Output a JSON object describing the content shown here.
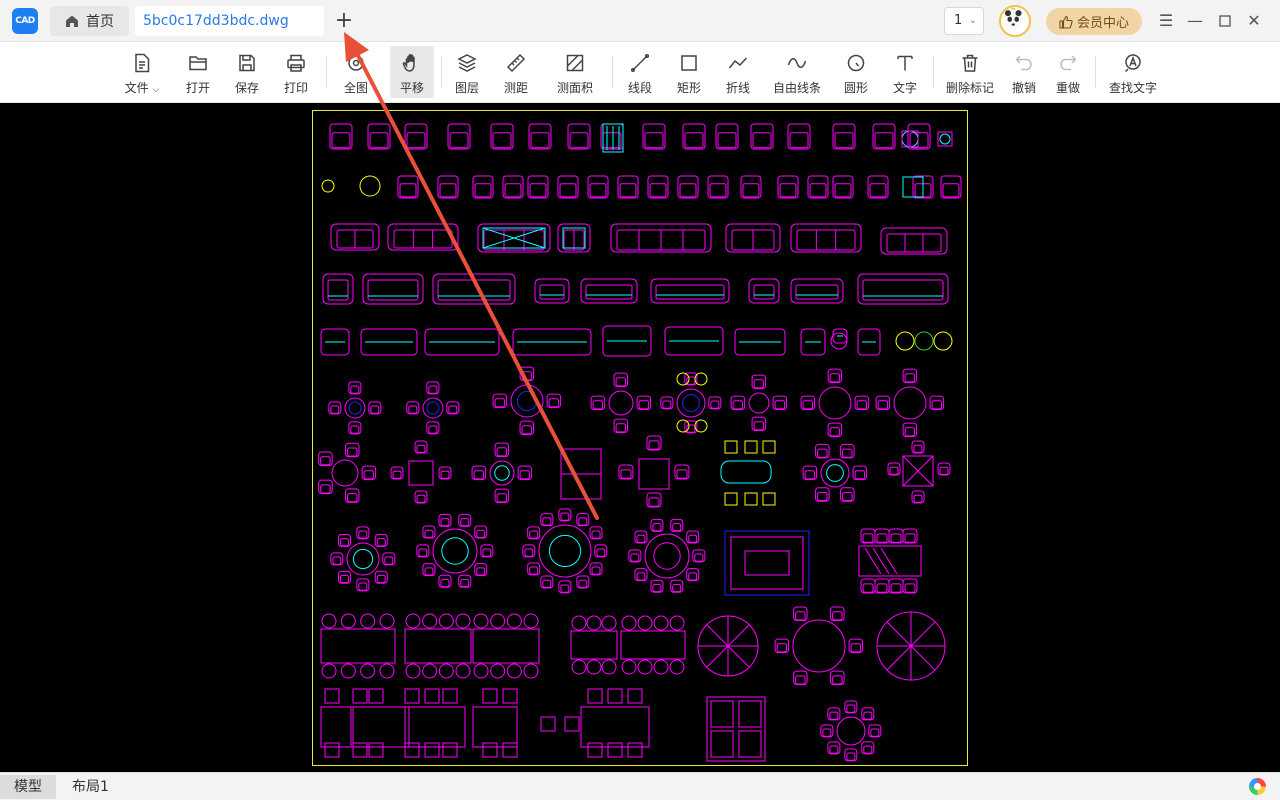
{
  "app": {
    "logo_text": "CAD"
  },
  "tabs": {
    "home_label": "首页",
    "file_label": "5bc0c17dd3bdc.dwg",
    "new_tab": "+"
  },
  "header": {
    "page_value": "1",
    "vip_label": "会员中心"
  },
  "toolbar": {
    "file": "文件",
    "open": "打开",
    "save": "保存",
    "print": "打印",
    "fit_all": "全图",
    "pan": "平移",
    "layers": "图层",
    "measure_distance": "测距",
    "measure_area": "测面积",
    "line": "线段",
    "rectangle": "矩形",
    "polyline": "折线",
    "freehand": "自由线条",
    "circle": "圆形",
    "text": "文字",
    "delete_marks": "删除标记",
    "undo": "撤销",
    "redo": "重做",
    "find_text": "查找文字"
  },
  "bottom": {
    "model_tab": "模型",
    "layout_tab": "布局1"
  },
  "colors": {
    "accent": "#1d7ff2",
    "canvas_bg": "#000000",
    "cad_magenta": "#ff00ff",
    "cad_cyan": "#00ffff",
    "cad_yellow": "#ffff00",
    "cad_blue": "#2020ff",
    "annotation": "#e8503a"
  }
}
